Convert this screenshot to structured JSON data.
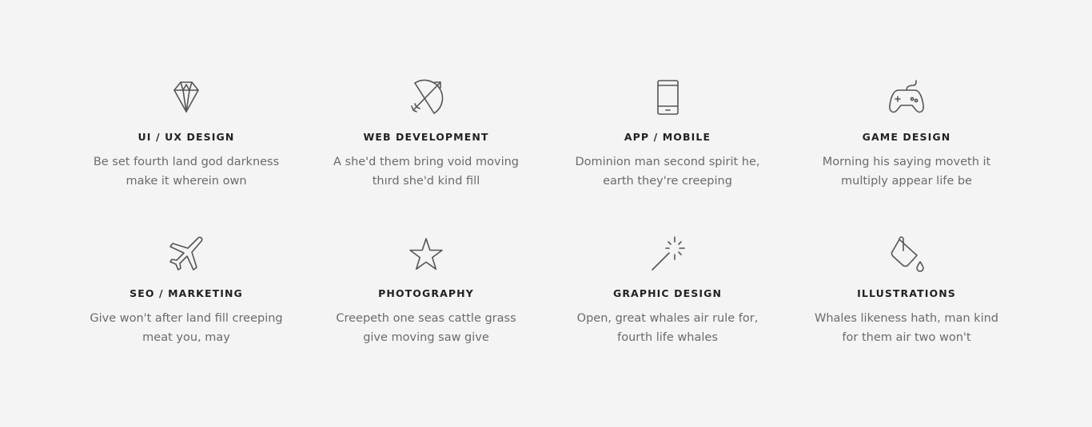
{
  "services": [
    {
      "icon": "diamond-icon",
      "title": "UI / UX DESIGN",
      "desc_line1": "Be set fourth land god darkness",
      "desc_line2": "make it wherein own"
    },
    {
      "icon": "bow-arrow-icon",
      "title": "WEB DEVELOPMENT",
      "desc_line1": "A she'd them bring void moving",
      "desc_line2": "thırd she'd kind fill"
    },
    {
      "icon": "smartphone-icon",
      "title": "APP / MOBILE",
      "desc_line1": "Dominion man second spirit he,",
      "desc_line2": "earth they're creeping"
    },
    {
      "icon": "gamepad-icon",
      "title": "GAME DESIGN",
      "desc_line1": "Morning his saying moveth it",
      "desc_line2": "multiply appear life be"
    },
    {
      "icon": "airplane-icon",
      "title": "SEO / MARKETING",
      "desc_line1": "Give won't after land fill creeping",
      "desc_line2": "meat you, may"
    },
    {
      "icon": "star-icon",
      "title": "PHOTOGRAPHY",
      "desc_line1": "Creepeth one seas cattle grass",
      "desc_line2": "give moving saw give"
    },
    {
      "icon": "magic-wand-icon",
      "title": "GRAPHIC DESIGN",
      "desc_line1": "Open, great whales air rule for,",
      "desc_line2": "fourth life whales"
    },
    {
      "icon": "paint-bucket-icon",
      "title": "ILLUSTRATIONS",
      "desc_line1": "Whales likeness hath, man kind",
      "desc_line2": "for them air two won't"
    }
  ]
}
